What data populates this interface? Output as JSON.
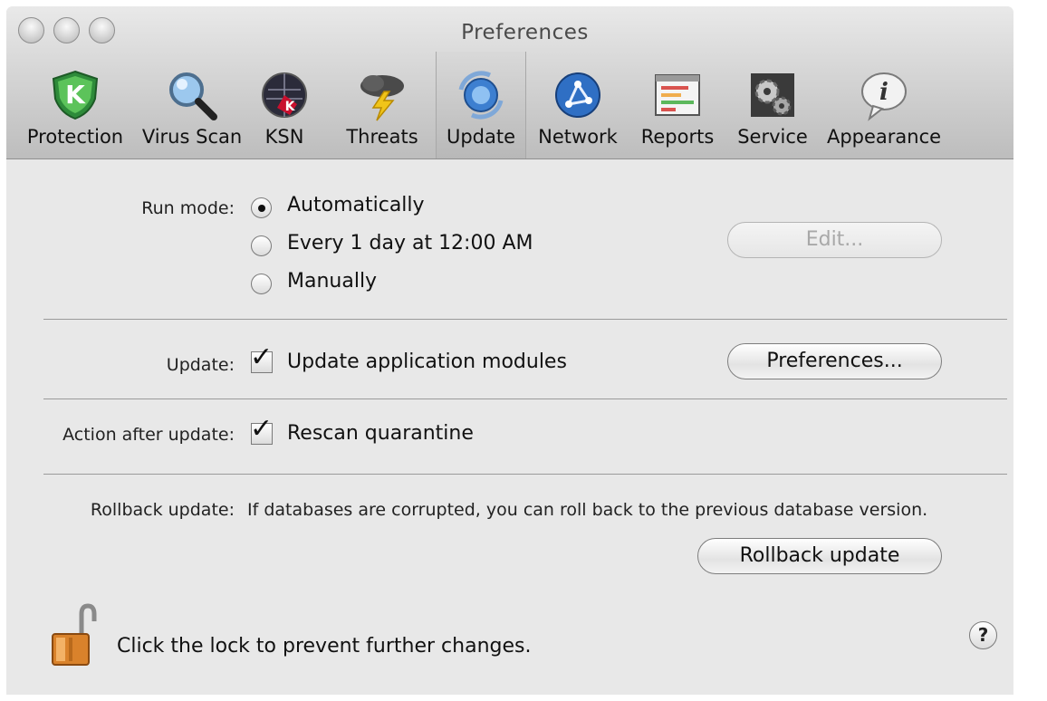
{
  "window": {
    "title": "Preferences"
  },
  "toolbar": {
    "items": [
      {
        "label": "Protection",
        "icon": "shield-k-icon"
      },
      {
        "label": "Virus Scan",
        "icon": "magnifier-icon"
      },
      {
        "label": "KSN",
        "icon": "ksn-globe-icon"
      },
      {
        "label": "Threats",
        "icon": "storm-cloud-icon"
      },
      {
        "label": "Update",
        "icon": "update-globe-icon",
        "selected": true
      },
      {
        "label": "Network",
        "icon": "network-globe-icon"
      },
      {
        "label": "Reports",
        "icon": "reports-chart-icon"
      },
      {
        "label": "Service",
        "icon": "gears-icon"
      },
      {
        "label": "Appearance",
        "icon": "info-bubble-icon"
      }
    ]
  },
  "run_mode": {
    "label": "Run mode:",
    "options": [
      {
        "label": "Automatically",
        "selected": true
      },
      {
        "label": "Every 1 day at 12:00 AM",
        "selected": false
      },
      {
        "label": "Manually",
        "selected": false
      }
    ],
    "edit_button": "Edit..."
  },
  "update": {
    "label": "Update:",
    "checkbox_label": "Update application modules",
    "checked": true,
    "preferences_button": "Preferences..."
  },
  "action_after_update": {
    "label": "Action after update:",
    "checkbox_label": "Rescan quarantine",
    "checked": true
  },
  "rollback": {
    "label": "Rollback update:",
    "description": "If databases are corrupted, you can roll back to the previous database version.",
    "button": "Rollback update"
  },
  "footer": {
    "lock_text": "Click the lock to prevent further changes.",
    "help": "?"
  },
  "colors": {
    "window_bg": "#e8e8e8",
    "toolbar_selected": "#c6c6c6"
  }
}
